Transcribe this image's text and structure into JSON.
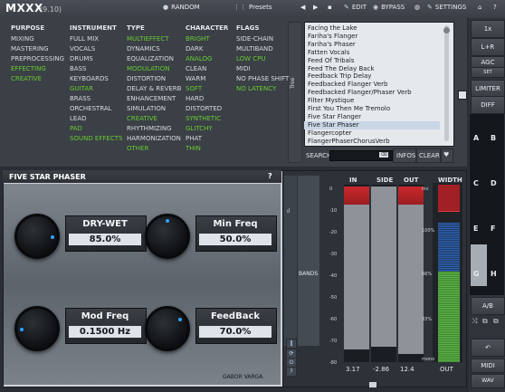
{
  "window": {
    "title": "MXXX",
    "version": "(9.10)"
  },
  "toolbar": {
    "random": "RANDOM",
    "presets": "Presets",
    "edit": "EDIT",
    "bypass": "BYPASS",
    "settings": "SETTINGS",
    "help": "?"
  },
  "browser": {
    "columns": [
      {
        "header": "PURPOSE",
        "items": [
          {
            "label": "MIXING",
            "active": false
          },
          {
            "label": "MASTERING",
            "active": false
          },
          {
            "label": "PREPROCESSING",
            "active": false
          },
          {
            "label": "EFFECTING",
            "active": true
          },
          {
            "label": "CREATIVE",
            "active": true
          }
        ]
      },
      {
        "header": "INSTRUMENT",
        "items": [
          {
            "label": "FULL MIX",
            "active": false
          },
          {
            "label": "VOCALS",
            "active": false
          },
          {
            "label": "DRUMS",
            "active": false
          },
          {
            "label": "BASS",
            "active": false
          },
          {
            "label": "KEYBOARDS",
            "active": false
          },
          {
            "label": "GUITAR",
            "active": true
          },
          {
            "label": "BRASS",
            "active": false
          },
          {
            "label": "ORCHESTRAL",
            "active": false
          },
          {
            "label": "LEAD",
            "active": false
          },
          {
            "label": "PAD",
            "active": true
          },
          {
            "label": "SOUND EFFECTS",
            "active": true
          }
        ]
      },
      {
        "header": "TYPE",
        "items": [
          {
            "label": "MULTIEFFECT",
            "active": true
          },
          {
            "label": "DYNAMICS",
            "active": false
          },
          {
            "label": "EQUALIZATION",
            "active": false
          },
          {
            "label": "MODULATION",
            "active": true
          },
          {
            "label": "DISTORTION",
            "active": false
          },
          {
            "label": "DELAY & REVERB",
            "active": false
          },
          {
            "label": "ENHANCEMENT",
            "active": false
          },
          {
            "label": "SIMULATION",
            "active": false
          },
          {
            "label": "CREATIVE",
            "active": true
          },
          {
            "label": "RHYTHMIZING",
            "active": false
          },
          {
            "label": "HARMONIZATION",
            "active": false
          },
          {
            "label": "OTHER",
            "active": true
          }
        ]
      },
      {
        "header": "CHARACTER",
        "items": [
          {
            "label": "BRIGHT",
            "active": true
          },
          {
            "label": "DARK",
            "active": false
          },
          {
            "label": "ANALOG",
            "active": true
          },
          {
            "label": "CLEAN",
            "active": false
          },
          {
            "label": "WARM",
            "active": false
          },
          {
            "label": "SOFT",
            "active": true
          },
          {
            "label": "HARD",
            "active": false
          },
          {
            "label": "DISTORTED",
            "active": false
          },
          {
            "label": "SYNTHETIC",
            "active": true
          },
          {
            "label": "GLITCHY",
            "active": true
          },
          {
            "label": "PHAT",
            "active": false
          },
          {
            "label": "THIN",
            "active": true
          }
        ]
      },
      {
        "header": "FLAGS",
        "items": [
          {
            "label": "SIDE-CHAIN",
            "active": false
          },
          {
            "label": "MULTIBAND",
            "active": false
          },
          {
            "label": "LOW CPU",
            "active": true
          },
          {
            "label": "MIDI",
            "active": false
          },
          {
            "label": "NO PHASE SHIFT",
            "active": false
          },
          {
            "label": "NO LATENCY",
            "active": true
          }
        ]
      }
    ],
    "tree_label": "Tree",
    "presets": [
      "Facing the Lake",
      "Fariha's Flanger",
      "Fariha's Phaser",
      "Fatten Vocals",
      "Feed Of Tribals",
      "Feed The Delay Back",
      "Feedback Trip Delay",
      "Feedbacked Flanger Verb",
      "Feedbacked Flanger/Phaser Verb",
      "Filter Mystique",
      "First You Then Me Tremolo",
      "Five Star Flanger",
      "Five Star Phaser",
      "Flangercopter",
      "FlangerPhaserChorusVerb"
    ],
    "selected_index": 12,
    "search_label": "SEARCH",
    "search_value": "",
    "infos": "INFOS",
    "clear": "CLEAR"
  },
  "right_panel": {
    "one_x": "1x",
    "l_r": "L+R",
    "agc": "AGC",
    "set": "SET",
    "limiter": "LIMITER",
    "diff": "DIFF",
    "slots": [
      "A",
      "B",
      "C",
      "D",
      "E",
      "F",
      "G",
      "H"
    ],
    "ab": "A/B",
    "midi": "MIDI",
    "wav": "WAV"
  },
  "plugin": {
    "title": "FIVE STAR PHASER",
    "help": "?",
    "params": [
      {
        "name": "DRY-WET",
        "value": "85.0%",
        "level": 0.85
      },
      {
        "name": "Min Freq",
        "value": "50.0%",
        "level": 0.5
      },
      {
        "name": "Mod Freq",
        "value": "0.1500 Hz",
        "level": 0.15
      },
      {
        "name": "FeedBack",
        "value": "70.0%",
        "level": 0.7
      }
    ],
    "author": "GABOR VARGA"
  },
  "analyzer": {
    "bands_label": "BANDS",
    "headers": {
      "in": "IN",
      "side": "SIDE",
      "out": "OUT",
      "width": "WIDTH"
    },
    "db_scale": [
      "0",
      "-10",
      "-20",
      "-30",
      "-40",
      "-50",
      "-60",
      "-70",
      "-80"
    ],
    "values": {
      "in": "3.17",
      "side": "-2.86",
      "out": "12.4",
      "width": "OUT"
    },
    "width_scale": [
      "inv",
      "100%",
      "66%",
      "33%",
      "mono"
    ],
    "levels": {
      "in": 0.92,
      "side": 0.9,
      "out": 0.95
    }
  }
}
